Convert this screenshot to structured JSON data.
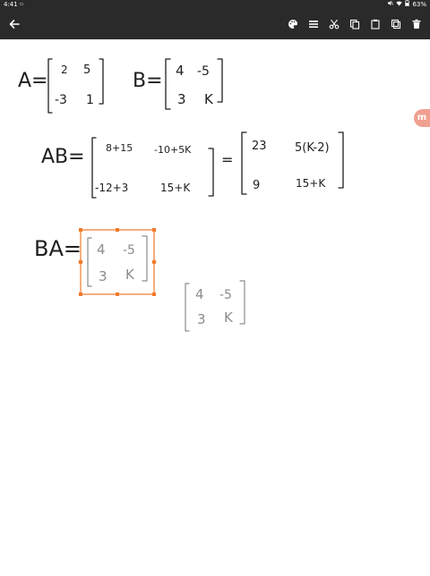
{
  "status_bar": {
    "time": "4:41",
    "battery": "63%",
    "icons": [
      "status-notification-icon",
      "mute-icon",
      "wifi-icon",
      "battery-icon"
    ]
  },
  "toolbar": {
    "back_icon": "arrow-left-icon",
    "tools": [
      {
        "name": "palette-icon"
      },
      {
        "name": "menu-lines-icon"
      },
      {
        "name": "scissors-icon"
      },
      {
        "name": "copy-icon"
      },
      {
        "name": "paste-icon"
      },
      {
        "name": "duplicate-icon"
      },
      {
        "name": "trash-icon"
      }
    ]
  },
  "colors": {
    "bar_background": "#2a2a2a",
    "ink": "#1f1f1f",
    "pasted_ink": "#8c8c8c",
    "selection": "#f07a2a",
    "side_badge": "#f0a090"
  },
  "side_badge": {
    "label": "m"
  },
  "canvas": {
    "line1": {
      "A_label": "A=",
      "A": [
        "2",
        "5",
        "-3",
        "1"
      ],
      "B_label": "B=",
      "B": [
        "4",
        "-5",
        "3",
        "K"
      ]
    },
    "line2": {
      "AB_label": "AB=",
      "AB": [
        "8+15",
        "-10+5K",
        "-12+3",
        "15+K"
      ],
      "equals": "=",
      "result": [
        "23",
        "5(K-2)",
        "9",
        "15+K"
      ]
    },
    "line3": {
      "BA_label": "BA=",
      "selected_copy": [
        "4",
        "-5",
        "3",
        "K"
      ],
      "pasted_copy": [
        "4",
        "-5",
        "3",
        "K"
      ]
    }
  }
}
